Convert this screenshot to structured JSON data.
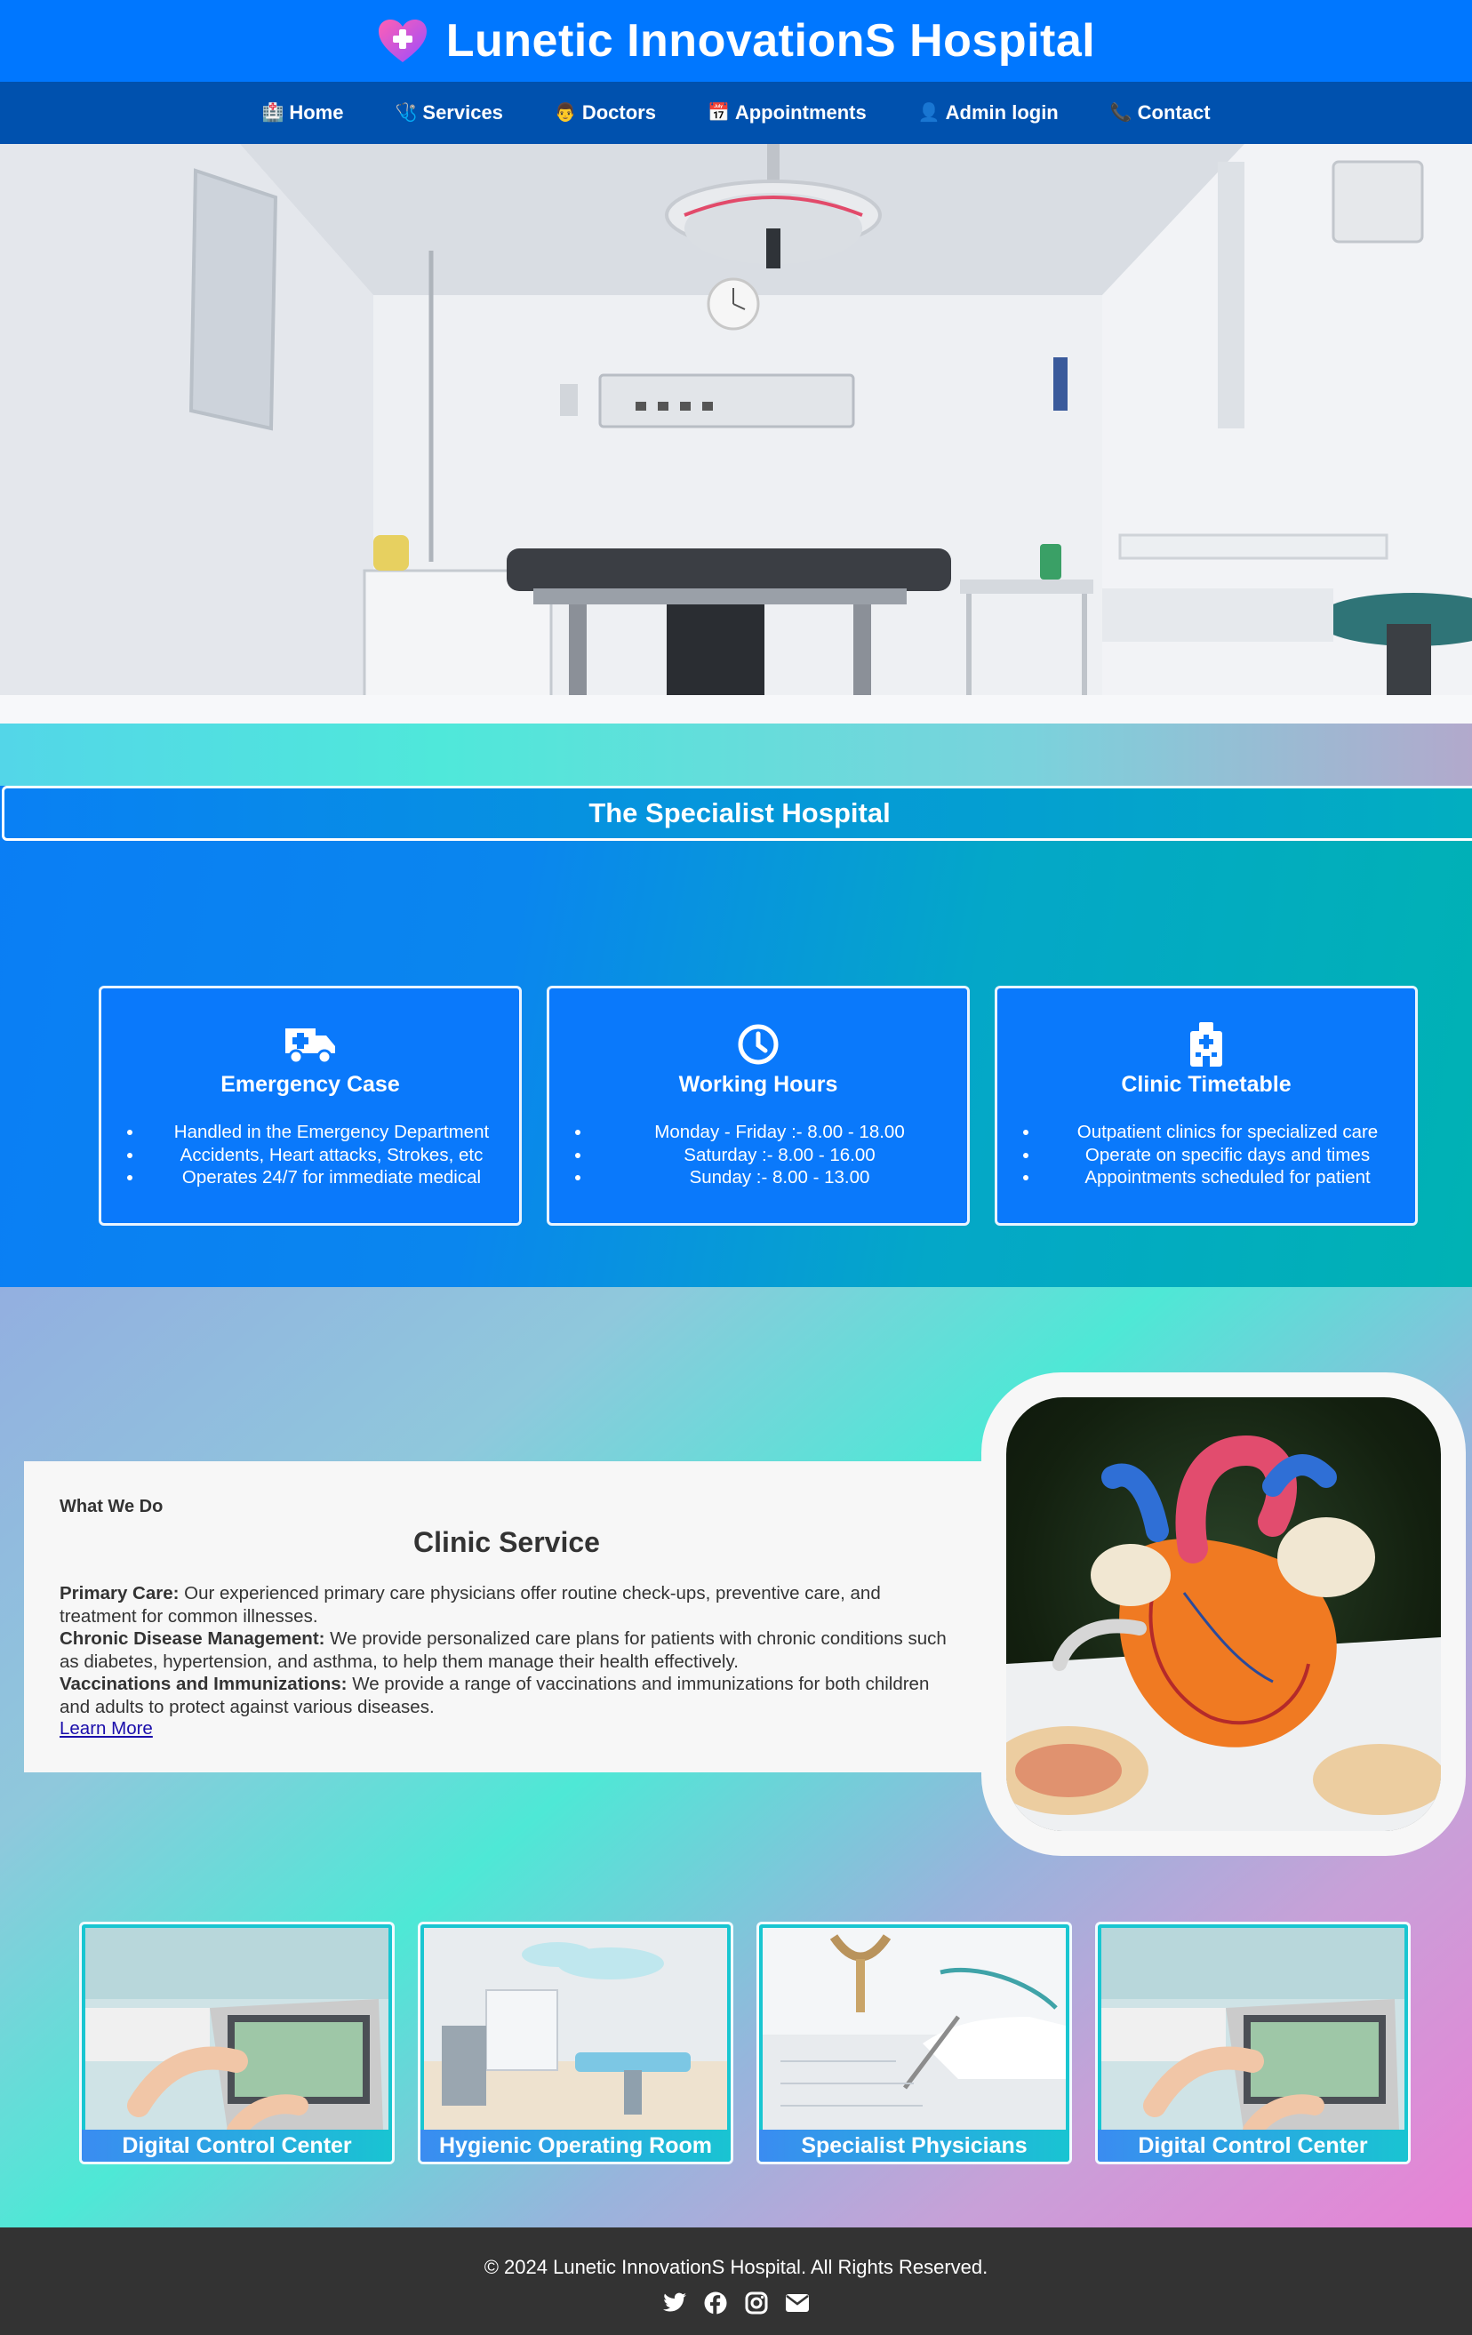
{
  "header": {
    "title": "Lunetic InnovationS Hospital",
    "logo_icon": "heart-plus-icon"
  },
  "nav": [
    {
      "label": "Home",
      "icon": "🏥"
    },
    {
      "label": "Services",
      "icon": "🩺"
    },
    {
      "label": "Doctors",
      "icon": "👨"
    },
    {
      "label": "Appointments",
      "icon": "📅"
    },
    {
      "label": "Admin login",
      "icon": "👤"
    },
    {
      "label": "Contact",
      "icon": "📞"
    }
  ],
  "specialist": {
    "heading": "The Specialist Hospital",
    "cards": [
      {
        "icon": "ambulance-icon",
        "title": "Emergency Case",
        "items": [
          "Handled in the Emergency Department",
          "Accidents, Heart attacks, Strokes, etc",
          "Operates 24/7 for immediate medical"
        ]
      },
      {
        "icon": "clock-icon",
        "title": "Working Hours",
        "items": [
          "Monday - Friday :- 8.00 - 18.00",
          "Saturday :- 8.00 - 16.00",
          "Sunday :- 8.00 - 13.00"
        ]
      },
      {
        "icon": "hospital-building-icon",
        "title": "Clinic Timetable",
        "items": [
          "Outpatient clinics for specialized care",
          "Operate on specific days and times",
          "Appointments scheduled for patient"
        ]
      }
    ]
  },
  "what_we_do": {
    "eyebrow": "What We Do",
    "title": "Clinic Service",
    "paragraphs": [
      {
        "label": "Primary Care:",
        "text": " Our experienced primary care physicians offer routine check-ups, preventive care, and treatment for common illnesses."
      },
      {
        "label": "Chronic Disease Management:",
        "text": " We provide personalized care plans for patients with chronic conditions such as diabetes, hypertension, and asthma, to help them manage their health effectively."
      },
      {
        "label": "Vaccinations and Immunizations:",
        "text": " We provide a range of vaccinations and immunizations for both children and adults to protect against various diseases."
      }
    ],
    "link": "Learn More"
  },
  "gallery": [
    {
      "caption": "Digital Control Center"
    },
    {
      "caption": "Hygienic Operating Room"
    },
    {
      "caption": "Specialist Physicians"
    },
    {
      "caption": "Digital Control Center"
    }
  ],
  "footer": {
    "copyright": "© 2024 Lunetic InnovationS Hospital. All Rights Reserved.",
    "socials": [
      "twitter-icon",
      "facebook-icon",
      "instagram-icon",
      "envelope-icon"
    ]
  },
  "colors": {
    "header": "#0077ff",
    "nav": "#0051ae",
    "card": "#0a79fb",
    "footer": "#333333"
  }
}
